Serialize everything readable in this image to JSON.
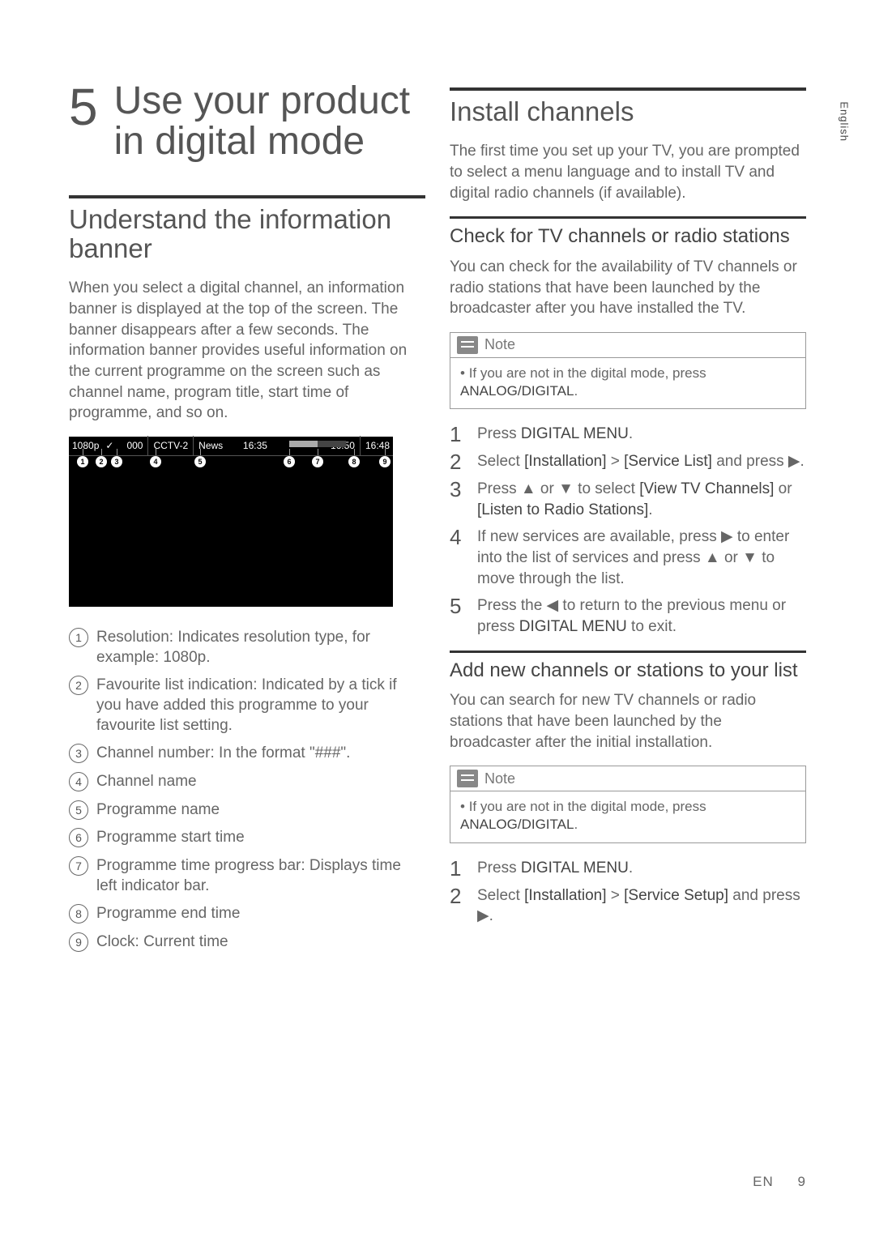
{
  "sideTab": "English",
  "chapter": {
    "num": "5",
    "title": "Use your product in digital mode"
  },
  "left": {
    "h2": "Understand the information banner",
    "intro": "When you select a digital channel, an information banner is displayed at the top of the screen. The banner disappears after a few seconds. The information banner provides useful information on the current programme on the screen such as channel name, program title, start time of programme, and so on.",
    "banner": {
      "res": "1080p",
      "check": "✓",
      "chnum": "000",
      "chname": "CCTV-2",
      "prog": "News",
      "start": "16:35",
      "end": "16:50",
      "clock": "16:48"
    },
    "legend": [
      "Resolution: Indicates resolution type, for example: 1080p.",
      "Favourite list indication: Indicated by a tick if you have added this programme to your favourite list setting.",
      "Channel number: In the format \"###\".",
      "Channel name",
      "Programme name",
      "Programme start time",
      "Programme time progress bar: Displays time left indicator bar.",
      "Programme end time",
      "Clock: Current time"
    ]
  },
  "right": {
    "h2": "Install channels",
    "intro": "The first time you set up your TV, you are prompted to select a menu language and to install TV and digital radio channels (if available).",
    "sec1": {
      "h3": "Check for TV channels or radio stations",
      "body": "You can check for the availability of TV channels or radio stations that have been launched by the broadcaster after you have installed the TV.",
      "noteLabel": "Note",
      "note": "If you are not in the digital mode, press ",
      "noteBold": "ANALOG/DIGITAL",
      "steps": [
        {
          "pre": "Press ",
          "b1": "DIGITAL MENU",
          "post": "."
        },
        {
          "pre": "Select ",
          "b1": "[Installation]",
          "mid": " > ",
          "b2": "[Service List]",
          "post": " and press ▶."
        },
        {
          "pre": "Press ▲ or ▼ to select ",
          "b1": "[View TV Channels]",
          "mid": " or ",
          "b2": "[Listen to Radio Stations]",
          "post": "."
        },
        {
          "pre": "If new services are available, press ▶ to enter into the list of services and press ▲ or ▼ to move through the list."
        },
        {
          "pre": "Press the ◀ to return to the previous menu or press ",
          "b1": "DIGITAL MENU",
          "post": " to exit."
        }
      ]
    },
    "sec2": {
      "h3": "Add new channels or stations to your list",
      "body": "You can search for new TV channels or radio stations that have been launched by the broadcaster after the initial installation.",
      "noteLabel": "Note",
      "note": "If you are not in the digital mode, press ",
      "noteBold": "ANALOG/DIGITAL",
      "steps": [
        {
          "pre": "Press ",
          "b1": "DIGITAL MENU",
          "post": "."
        },
        {
          "pre": "Select ",
          "b1": "[Installation]",
          "mid": " > ",
          "b2": "[Service Setup]",
          "post": " and press ▶."
        }
      ]
    }
  },
  "footer": {
    "lang": "EN",
    "page": "9"
  }
}
